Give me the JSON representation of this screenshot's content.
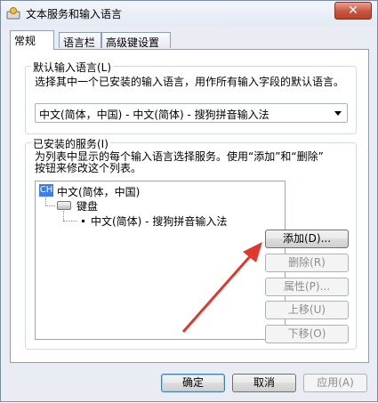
{
  "window": {
    "title": "文本服务和输入语言"
  },
  "tabs": [
    {
      "label": "常规",
      "active": true
    },
    {
      "label": "语言栏",
      "active": false
    },
    {
      "label": "高级键设置",
      "active": false
    }
  ],
  "default_lang": {
    "title": "默认输入语言(L)",
    "description": "选择其中一个已安装的输入语言，用作所有输入字段的默认语言。",
    "selected": "中文(简体，中国) - 中文(简体) - 搜狗拼音输入法"
  },
  "installed": {
    "title": "已安装的服务(I)",
    "description_line1": "为列表中显示的每个输入语言选择服务。使用“添加”和“删除”",
    "description_line2": "按钮来修改这个列表。",
    "tree": {
      "lang_badge": "CH",
      "language": "中文(简体，中国)",
      "category": "键盘",
      "service": "中文(简体) - 搜狗拼音输入法"
    }
  },
  "side_buttons": {
    "add": "添加(D)...",
    "remove": "删除(R)",
    "properties": "属性(P)...",
    "move_up": "上移(U)",
    "move_down": "下移(O)"
  },
  "footer": {
    "ok": "确定",
    "cancel": "取消",
    "apply": "应用(A)"
  },
  "colors": {
    "annotation_arrow": "#e0392b",
    "lang_badge": "#3e7ee6"
  },
  "icons": {
    "app": "keyboard-globe-icon",
    "close": "close-icon",
    "keyboard": "keyboard-icon"
  }
}
